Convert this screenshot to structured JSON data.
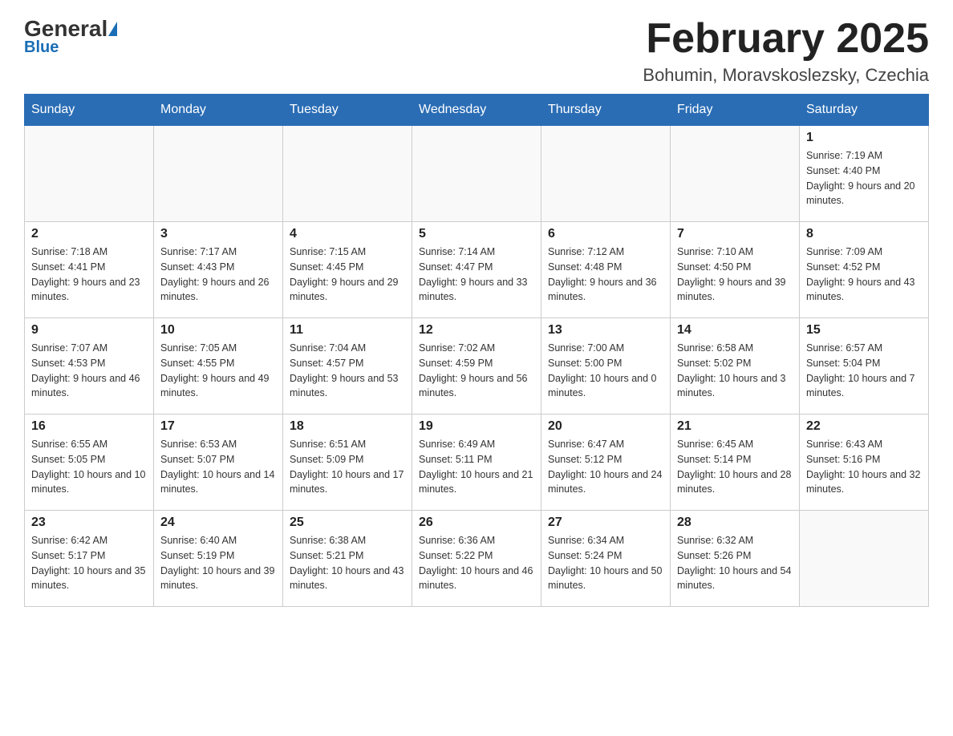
{
  "header": {
    "logo": {
      "general": "General",
      "blue": "Blue"
    },
    "title": "February 2025",
    "location": "Bohumin, Moravskoslezsky, Czechia"
  },
  "weekdays": [
    "Sunday",
    "Monday",
    "Tuesday",
    "Wednesday",
    "Thursday",
    "Friday",
    "Saturday"
  ],
  "weeks": [
    [
      {
        "day": "",
        "info": ""
      },
      {
        "day": "",
        "info": ""
      },
      {
        "day": "",
        "info": ""
      },
      {
        "day": "",
        "info": ""
      },
      {
        "day": "",
        "info": ""
      },
      {
        "day": "",
        "info": ""
      },
      {
        "day": "1",
        "info": "Sunrise: 7:19 AM\nSunset: 4:40 PM\nDaylight: 9 hours and 20 minutes."
      }
    ],
    [
      {
        "day": "2",
        "info": "Sunrise: 7:18 AM\nSunset: 4:41 PM\nDaylight: 9 hours and 23 minutes."
      },
      {
        "day": "3",
        "info": "Sunrise: 7:17 AM\nSunset: 4:43 PM\nDaylight: 9 hours and 26 minutes."
      },
      {
        "day": "4",
        "info": "Sunrise: 7:15 AM\nSunset: 4:45 PM\nDaylight: 9 hours and 29 minutes."
      },
      {
        "day": "5",
        "info": "Sunrise: 7:14 AM\nSunset: 4:47 PM\nDaylight: 9 hours and 33 minutes."
      },
      {
        "day": "6",
        "info": "Sunrise: 7:12 AM\nSunset: 4:48 PM\nDaylight: 9 hours and 36 minutes."
      },
      {
        "day": "7",
        "info": "Sunrise: 7:10 AM\nSunset: 4:50 PM\nDaylight: 9 hours and 39 minutes."
      },
      {
        "day": "8",
        "info": "Sunrise: 7:09 AM\nSunset: 4:52 PM\nDaylight: 9 hours and 43 minutes."
      }
    ],
    [
      {
        "day": "9",
        "info": "Sunrise: 7:07 AM\nSunset: 4:53 PM\nDaylight: 9 hours and 46 minutes."
      },
      {
        "day": "10",
        "info": "Sunrise: 7:05 AM\nSunset: 4:55 PM\nDaylight: 9 hours and 49 minutes."
      },
      {
        "day": "11",
        "info": "Sunrise: 7:04 AM\nSunset: 4:57 PM\nDaylight: 9 hours and 53 minutes."
      },
      {
        "day": "12",
        "info": "Sunrise: 7:02 AM\nSunset: 4:59 PM\nDaylight: 9 hours and 56 minutes."
      },
      {
        "day": "13",
        "info": "Sunrise: 7:00 AM\nSunset: 5:00 PM\nDaylight: 10 hours and 0 minutes."
      },
      {
        "day": "14",
        "info": "Sunrise: 6:58 AM\nSunset: 5:02 PM\nDaylight: 10 hours and 3 minutes."
      },
      {
        "day": "15",
        "info": "Sunrise: 6:57 AM\nSunset: 5:04 PM\nDaylight: 10 hours and 7 minutes."
      }
    ],
    [
      {
        "day": "16",
        "info": "Sunrise: 6:55 AM\nSunset: 5:05 PM\nDaylight: 10 hours and 10 minutes."
      },
      {
        "day": "17",
        "info": "Sunrise: 6:53 AM\nSunset: 5:07 PM\nDaylight: 10 hours and 14 minutes."
      },
      {
        "day": "18",
        "info": "Sunrise: 6:51 AM\nSunset: 5:09 PM\nDaylight: 10 hours and 17 minutes."
      },
      {
        "day": "19",
        "info": "Sunrise: 6:49 AM\nSunset: 5:11 PM\nDaylight: 10 hours and 21 minutes."
      },
      {
        "day": "20",
        "info": "Sunrise: 6:47 AM\nSunset: 5:12 PM\nDaylight: 10 hours and 24 minutes."
      },
      {
        "day": "21",
        "info": "Sunrise: 6:45 AM\nSunset: 5:14 PM\nDaylight: 10 hours and 28 minutes."
      },
      {
        "day": "22",
        "info": "Sunrise: 6:43 AM\nSunset: 5:16 PM\nDaylight: 10 hours and 32 minutes."
      }
    ],
    [
      {
        "day": "23",
        "info": "Sunrise: 6:42 AM\nSunset: 5:17 PM\nDaylight: 10 hours and 35 minutes."
      },
      {
        "day": "24",
        "info": "Sunrise: 6:40 AM\nSunset: 5:19 PM\nDaylight: 10 hours and 39 minutes."
      },
      {
        "day": "25",
        "info": "Sunrise: 6:38 AM\nSunset: 5:21 PM\nDaylight: 10 hours and 43 minutes."
      },
      {
        "day": "26",
        "info": "Sunrise: 6:36 AM\nSunset: 5:22 PM\nDaylight: 10 hours and 46 minutes."
      },
      {
        "day": "27",
        "info": "Sunrise: 6:34 AM\nSunset: 5:24 PM\nDaylight: 10 hours and 50 minutes."
      },
      {
        "day": "28",
        "info": "Sunrise: 6:32 AM\nSunset: 5:26 PM\nDaylight: 10 hours and 54 minutes."
      },
      {
        "day": "",
        "info": ""
      }
    ]
  ]
}
